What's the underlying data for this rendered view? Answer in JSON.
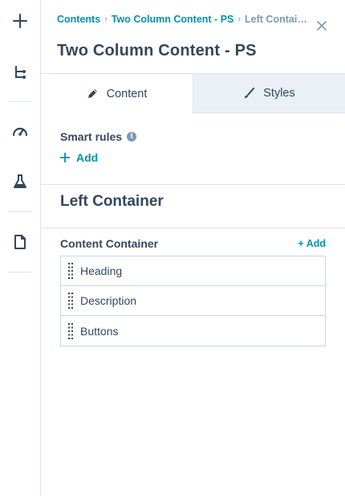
{
  "rail": {
    "items": [
      {
        "icon": "plus-icon"
      },
      {
        "icon": "tree-structure-icon"
      },
      {
        "icon": "speedometer-icon"
      },
      {
        "icon": "flask-icon"
      },
      {
        "icon": "document-icon"
      }
    ]
  },
  "header": {
    "breadcrumb": [
      "Contents",
      "Two Column Content - PS",
      "Left Contai…"
    ],
    "title": "Two Column Content - PS"
  },
  "tabs": [
    {
      "label": "Content",
      "icon": "pencil-icon",
      "active": true
    },
    {
      "label": "Styles",
      "icon": "brush-icon",
      "active": false
    }
  ],
  "smart_rules": {
    "label": "Smart rules",
    "add_label": "Add"
  },
  "section": {
    "title": "Left Container"
  },
  "content_container": {
    "label": "Content Container",
    "add_label": "+ Add",
    "items": [
      "Heading",
      "Description",
      "Buttons"
    ]
  },
  "colors": {
    "accent": "#0091ae",
    "text": "#33475b",
    "muted": "#7c98b6",
    "border": "#dfe3eb",
    "tab_inactive_bg": "#eaf0f6"
  }
}
